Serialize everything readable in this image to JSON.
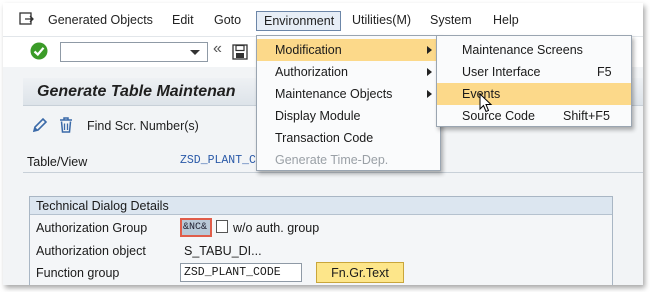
{
  "menubar": {
    "items": [
      "Generated Objects",
      "Edit",
      "Goto",
      "Environment",
      "Utilities(M)",
      "System",
      "Help"
    ]
  },
  "title": "Generate Table Maintenan",
  "app_toolbar": {
    "find_label": "Find Scr. Number(s)"
  },
  "table_view": {
    "label": "Table/View",
    "value": "ZSD_PLANT_C"
  },
  "group": {
    "title": "Technical Dialog Details",
    "auth_group_label": "Authorization Group",
    "auth_group_value": "&NC&",
    "wo_auth_label": "w/o auth. group",
    "auth_object_label": "Authorization object",
    "auth_object_value": "S_TABU_DI...",
    "function_group_label": "Function group",
    "function_group_value": "ZSD_PLANT_CODE",
    "fn_button_label": "Fn.Gr.Text"
  },
  "environment_menu": {
    "items": [
      {
        "label": "Modification",
        "submenu": true,
        "highlighted": true
      },
      {
        "label": "Authorization",
        "submenu": true
      },
      {
        "label": "Maintenance Objects",
        "submenu": true
      },
      {
        "label": "Display Module"
      },
      {
        "label": "Transaction Code"
      },
      {
        "label": "Generate Time-Dep.",
        "disabled": true
      }
    ]
  },
  "modification_submenu": {
    "items": [
      {
        "label": "Maintenance Screens",
        "shortcut": ""
      },
      {
        "label": "User Interface",
        "shortcut": "F5"
      },
      {
        "label": "Events",
        "shortcut": "",
        "highlighted": true
      },
      {
        "label": "Source Code",
        "shortcut": "Shift+F5"
      }
    ]
  },
  "colors": {
    "highlight": "#fcd98a",
    "ok_green": "#3b9b28",
    "field_blue": "#2b5aa8",
    "button_yellow": "#fde68a"
  },
  "icons": [
    "menu-icon",
    "ok-check-icon",
    "dropdown-arrow-icon",
    "double-left-arrow-icon",
    "save-icon",
    "pencil-icon",
    "trash-icon",
    "mouse-cursor-icon"
  ]
}
